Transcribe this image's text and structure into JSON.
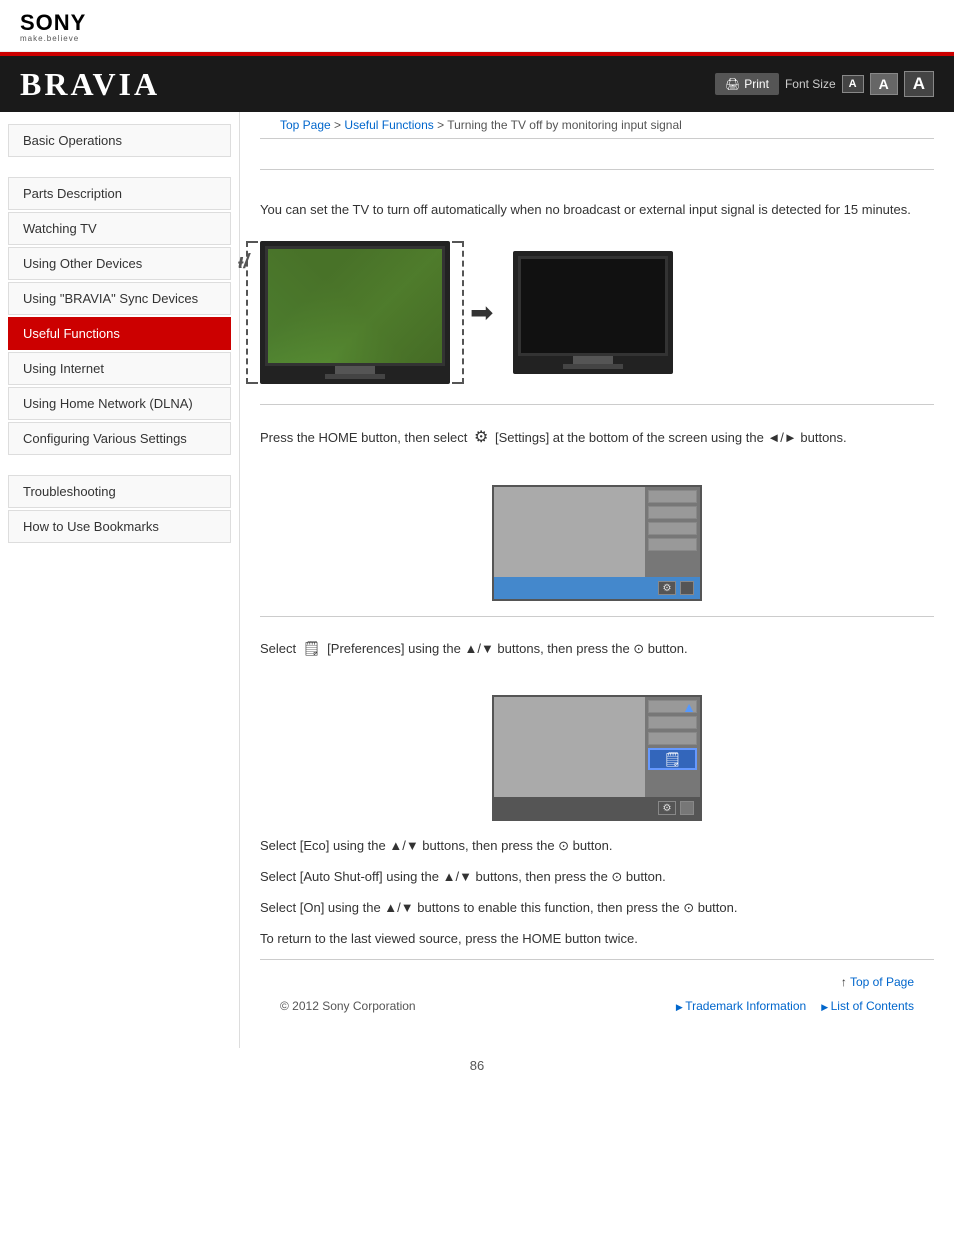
{
  "header": {
    "logo": "SONY",
    "tagline": "make.believe",
    "brand": "BRAVIA"
  },
  "toolbar": {
    "print_label": "Print",
    "font_size_label": "Font Size",
    "font_btn_small": "A",
    "font_btn_medium": "A",
    "font_btn_large": "A"
  },
  "breadcrumb": {
    "top_page": "Top Page",
    "separator1": " > ",
    "useful_functions": "Useful Functions",
    "separator2": " >  Turning the TV off by monitoring input signal"
  },
  "sidebar": {
    "items": [
      {
        "label": "Basic Operations",
        "active": false
      },
      {
        "label": "Parts Description",
        "active": false
      },
      {
        "label": "Watching TV",
        "active": false
      },
      {
        "label": "Using Other Devices",
        "active": false
      },
      {
        "label": "Using \"BRAVIA\" Sync Devices",
        "active": false
      },
      {
        "label": "Useful Functions",
        "active": true
      },
      {
        "label": "Using Internet",
        "active": false
      },
      {
        "label": "Using Home Network (DLNA)",
        "active": false
      },
      {
        "label": "Configuring Various Settings",
        "active": false
      },
      {
        "label": "Troubleshooting",
        "active": false
      },
      {
        "label": "How to Use Bookmarks",
        "active": false
      }
    ]
  },
  "content": {
    "description": "You can set the TV to turn off automatically when no broadcast or external input signal is detected for 15 minutes.",
    "step1": "Press the HOME button, then select",
    "step1_icon": "⚙",
    "step1_text": "[Settings] at the bottom of the screen using the ◄/► buttons.",
    "step2": "Select",
    "step2_icon": "🖹",
    "step2_text": "[Preferences] using the ▲/▼ buttons, then press the ⊙ button.",
    "step3": "Select [Eco] using the ▲/▼ buttons, then press the ⊙ button.",
    "step4": "Select [Auto Shut-off] using the ▲/▼ buttons, then press the ⊙ button.",
    "step5": "Select [On] using the ▲/▼ buttons to enable this function, then press the ⊙ button.",
    "return_text": "To return to the last viewed source, press the HOME button twice."
  },
  "footer": {
    "top_of_page": "Top of Page",
    "copyright": "© 2012 Sony Corporation",
    "trademark": "Trademark Information",
    "list_of_contents": "List of Contents",
    "page_number": "86"
  }
}
